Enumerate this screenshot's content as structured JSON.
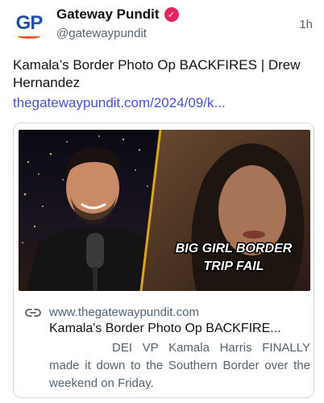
{
  "account": {
    "avatar_text": "GP",
    "name": "Gateway Pundit",
    "handle": "@gatewaypundit",
    "time": "1h",
    "verified_icon": "verified-badge-icon"
  },
  "post": {
    "text": "Kamala’s Border Photo Op BACKFIRES | Drew Hernandez",
    "link": "thegatewaypundit.com/2024/09/k..."
  },
  "card": {
    "overlay_line1": "BIG GIRL BORDER",
    "overlay_line2": "TRIP FAIL",
    "domain": "www.thegatewaypundit.com",
    "title": "Kamala's Border Photo Op BACKFIRE...",
    "description": "DEI VP Kamala Harris FINALLY made it down to the Southern Border over the weekend on Friday.",
    "link_icon": "link-icon"
  },
  "colors": {
    "link": "#4b52c8",
    "verified": "#e0245e",
    "brand_blue": "#1f4ea8",
    "brand_orange": "#e8542a",
    "divider_gold": "#d9a520"
  }
}
